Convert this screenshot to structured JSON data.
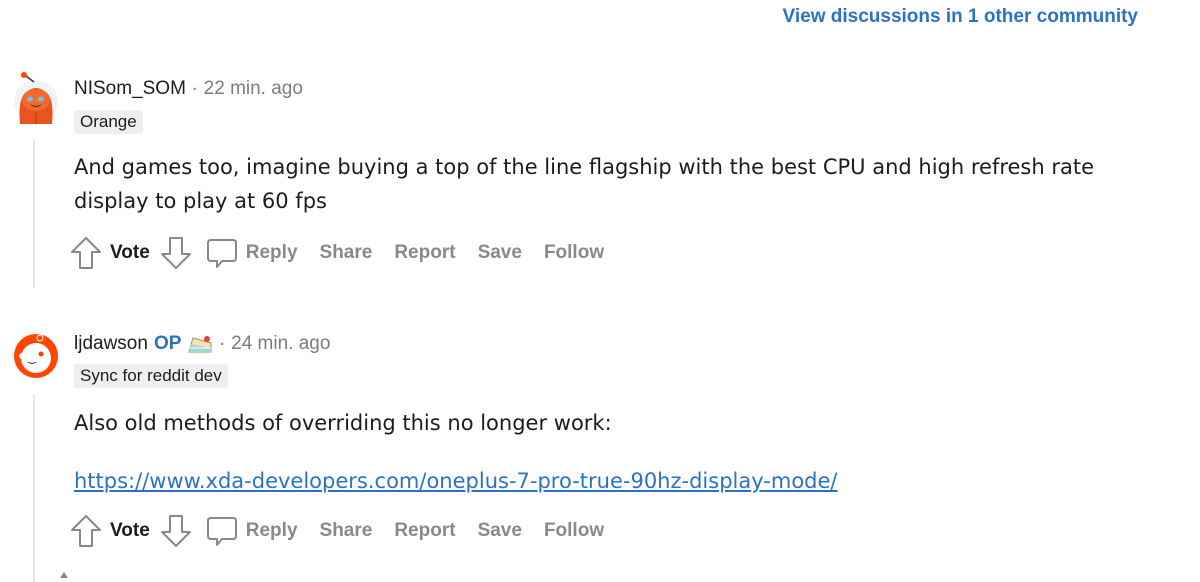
{
  "header": {
    "other_community_link": "View discussions in 1 other community"
  },
  "comments": [
    {
      "author": "NISom_SOM",
      "is_op": false,
      "separator": "·",
      "time": "22 min. ago",
      "flair": "Orange",
      "avatar_icon": "orange-snoo-avatar-icon",
      "body": [
        "And games too, imagine buying a top of the line flagship with the best CPU and high refresh rate display to play at 60 fps"
      ],
      "actions": {
        "vote": "Vote",
        "reply": "Reply",
        "share": "Share",
        "report": "Report",
        "save": "Save",
        "follow": "Follow"
      }
    },
    {
      "author": "ljdawson",
      "is_op": true,
      "op_label": "OP",
      "cake_day_icon": "cake-icon",
      "separator": "·",
      "time": "24 min. ago",
      "flair": "Sync for reddit dev",
      "avatar_icon": "default-snoo-avatar-icon",
      "body_text": "Also old methods of overriding this no longer work:",
      "body_link": "https://www.xda-developers.com/oneplus-7-pro-true-90hz-display-mode/",
      "actions": {
        "vote": "Vote",
        "reply": "Reply",
        "share": "Share",
        "report": "Report",
        "save": "Save",
        "follow": "Follow"
      }
    }
  ],
  "colors": {
    "link_blue": "#2b72c7",
    "muted_gray": "#878a8c",
    "flair_bg": "#edeff1",
    "snoo_orange": "#ff4500"
  }
}
